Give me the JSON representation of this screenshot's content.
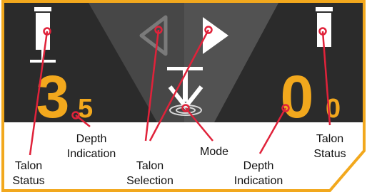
{
  "display": {
    "left_depth": {
      "whole": "3",
      "decimal": "5"
    },
    "right_depth": {
      "whole": "0",
      "decimal": "0"
    }
  },
  "labels": {
    "left_talon_status": [
      "Talon",
      "Status"
    ],
    "left_depth_indication": [
      "Depth",
      "Indication"
    ],
    "talon_selection": [
      "Talon",
      "Selection"
    ],
    "mode": "Mode",
    "right_depth_indication": [
      "Depth",
      "Indication"
    ],
    "right_talon_status": [
      "Talon",
      "Status"
    ]
  },
  "colors": {
    "frame": "#f2a81d",
    "screen": "#2b2b2b",
    "digits": "#f2a81d",
    "callout": "#e0223a",
    "icon": "#ffffff"
  }
}
